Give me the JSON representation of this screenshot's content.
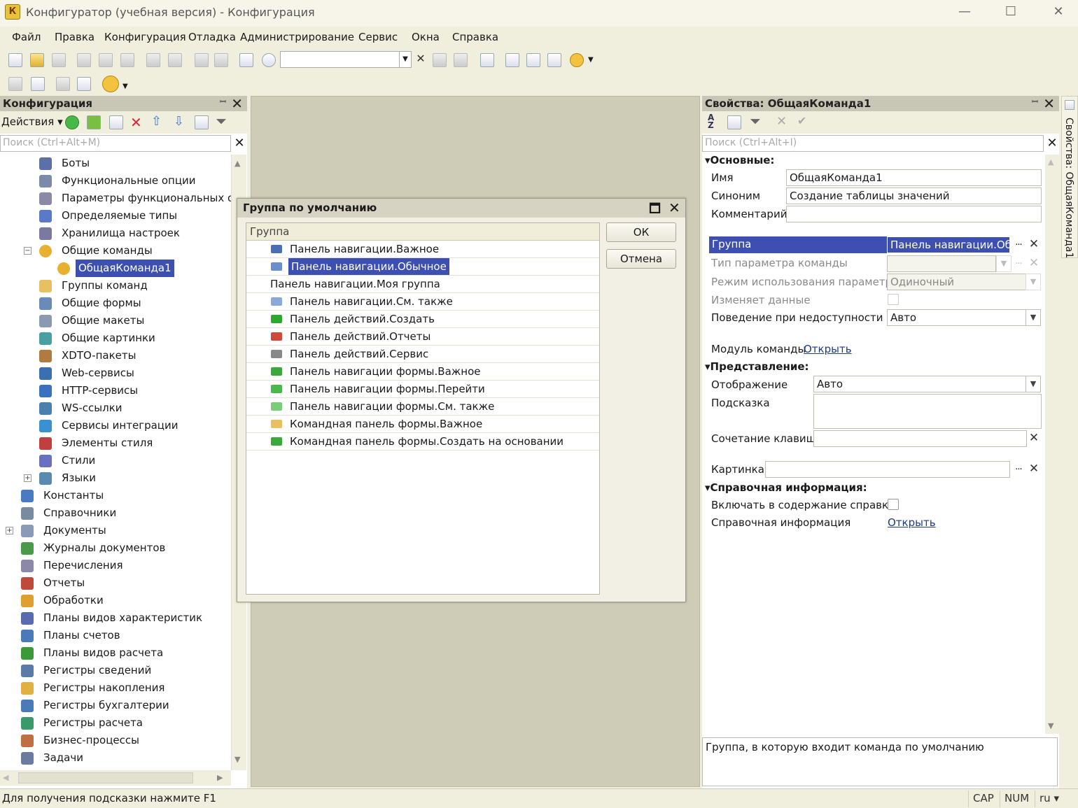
{
  "window": {
    "title": "Конфигуратор (учебная версия) - Конфигурация",
    "app_icon_letter": "К"
  },
  "menu": [
    "Файл",
    "Правка",
    "Конфигурация",
    "Отладка",
    "Администрирование",
    "Сервис",
    "Окна",
    "Справка"
  ],
  "left_panel": {
    "title": "Конфигурация",
    "actions_label": "Действия",
    "search_placeholder": "Поиск (Ctrl+Alt+M)",
    "tree": [
      {
        "label": "Боты",
        "icon": "bot-icon"
      },
      {
        "label": "Функциональные опции",
        "icon": "functional-options-icon"
      },
      {
        "label": "Параметры функциональных опций",
        "icon": "functional-params-icon"
      },
      {
        "label": "Определяемые типы",
        "icon": "defined-types-icon"
      },
      {
        "label": "Хранилища настроек",
        "icon": "settings-storage-icon"
      },
      {
        "label": "Общие команды",
        "icon": "common-commands-icon",
        "expander": "⊖"
      },
      {
        "label": "ОбщаяКоманда1",
        "icon": "command-icon",
        "selected": true
      },
      {
        "label": "Группы команд",
        "icon": "command-groups-icon"
      },
      {
        "label": "Общие формы",
        "icon": "forms-icon"
      },
      {
        "label": "Общие макеты",
        "icon": "templates-icon"
      },
      {
        "label": "Общие картинки",
        "icon": "pictures-icon"
      },
      {
        "label": "XDTO-пакеты",
        "icon": "xdto-icon"
      },
      {
        "label": "Web-сервисы",
        "icon": "web-services-icon"
      },
      {
        "label": "HTTP-сервисы",
        "icon": "http-services-icon"
      },
      {
        "label": "WS-ссылки",
        "icon": "ws-links-icon"
      },
      {
        "label": "Сервисы интеграции",
        "icon": "integration-icon"
      },
      {
        "label": "Элементы стиля",
        "icon": "style-items-icon"
      },
      {
        "label": "Стили",
        "icon": "styles-icon"
      },
      {
        "label": "Языки",
        "icon": "languages-icon",
        "expander": "⊕"
      },
      {
        "label": "Константы",
        "icon": "constants-icon"
      },
      {
        "label": "Справочники",
        "icon": "catalogs-icon"
      },
      {
        "label": "Документы",
        "icon": "documents-icon",
        "expander": "⊕"
      },
      {
        "label": "Журналы документов",
        "icon": "journals-icon"
      },
      {
        "label": "Перечисления",
        "icon": "enums-icon"
      },
      {
        "label": "Отчеты",
        "icon": "reports-icon"
      },
      {
        "label": "Обработки",
        "icon": "processing-icon"
      },
      {
        "label": "Планы видов характеристик",
        "icon": "chart-of-characteristics-icon"
      },
      {
        "label": "Планы счетов",
        "icon": "chart-of-accounts-icon"
      },
      {
        "label": "Планы видов расчета",
        "icon": "calc-types-icon"
      },
      {
        "label": "Регистры сведений",
        "icon": "info-registers-icon"
      },
      {
        "label": "Регистры накопления",
        "icon": "accum-registers-icon"
      },
      {
        "label": "Регистры бухгалтерии",
        "icon": "accounting-registers-icon"
      },
      {
        "label": "Регистры расчета",
        "icon": "calc-registers-icon"
      },
      {
        "label": "Бизнес-процессы",
        "icon": "business-processes-icon"
      },
      {
        "label": "Задачи",
        "icon": "tasks-icon"
      }
    ]
  },
  "dialog": {
    "title": "Группа по умолчанию",
    "column_header": "Группа",
    "ok_label": "ОК",
    "cancel_label": "Отмена",
    "rows": [
      {
        "label": "Панель навигации.Важное",
        "icon": "nav-important-icon",
        "color": "#4a6fb5"
      },
      {
        "label": "Панель навигации.Обычное",
        "icon": "nav-normal-icon",
        "color": "#6a8fd0",
        "selected": true
      },
      {
        "label": "Панель навигации.Моя группа",
        "icon": "",
        "color": ""
      },
      {
        "label": "Панель навигации.См. также",
        "icon": "nav-see-also-icon",
        "color": "#8aa8d8"
      },
      {
        "label": "Панель действий.Создать",
        "icon": "actions-create-icon",
        "color": "#2fa82f"
      },
      {
        "label": "Панель действий.Отчеты",
        "icon": "actions-reports-icon",
        "color": "#d04a3a"
      },
      {
        "label": "Панель действий.Сервис",
        "icon": "actions-service-icon",
        "color": "#888888"
      },
      {
        "label": "Панель навигации формы.Важное",
        "icon": "form-nav-important-icon",
        "color": "#3aa83a"
      },
      {
        "label": "Панель навигации формы.Перейти",
        "icon": "form-nav-goto-icon",
        "color": "#4ab84a"
      },
      {
        "label": "Панель навигации формы.См. также",
        "icon": "form-nav-see-also-icon",
        "color": "#7acb7a"
      },
      {
        "label": "Командная панель формы.Важное",
        "icon": "form-cmd-important-icon",
        "color": "#e8c060"
      },
      {
        "label": "Командная панель формы.Создать на основании",
        "icon": "form-cmd-create-based-icon",
        "color": "#3aa83a"
      }
    ]
  },
  "properties": {
    "title": "Свойства: ОбщаяКоманда1",
    "search_placeholder": "Поиск (Ctrl+Alt+I)",
    "sections": {
      "main": "Основные:",
      "presentation": "Представление:",
      "help": "Справочная информация:"
    },
    "name_label": "Имя",
    "name_value": "ОбщаяКоманда1",
    "synonym_label": "Синоним",
    "synonym_value": "Создание таблицы значений",
    "comment_label": "Комментарий",
    "comment_value": "",
    "group_label": "Группа",
    "group_value": "Панель навигации.Обы",
    "param_type_label": "Тип параметра команды",
    "param_type_value": "",
    "param_mode_label": "Режим использования параметра",
    "param_mode_value": "Одиночный",
    "modifies_label": "Изменяет данные",
    "behavior_label": "Поведение при недоступности ос",
    "behavior_value": "Авто",
    "module_label": "Модуль команды",
    "module_link": "Открыть",
    "display_label": "Отображение",
    "display_value": "Авто",
    "tooltip_label": "Подсказка",
    "tooltip_value": "",
    "shortcut_label": "Сочетание клавиш",
    "shortcut_value": "",
    "picture_label": "Картинка",
    "picture_value": "",
    "include_help_label": "Включать в содержание справки",
    "help_info_label": "Справочная информация",
    "help_info_link": "Открыть",
    "description": "Группа, в которую входит команда по умолчанию"
  },
  "side_tab": "Свойства: ОбщаяКоманда1",
  "status": {
    "message": "Для получения подсказки нажмите F1",
    "cap": "CAP",
    "num": "NUM",
    "lang": "ru"
  },
  "colors": {
    "selection": "#3d4fb0",
    "panel_header": "#c8c6b4",
    "background": "#f0eedd"
  }
}
